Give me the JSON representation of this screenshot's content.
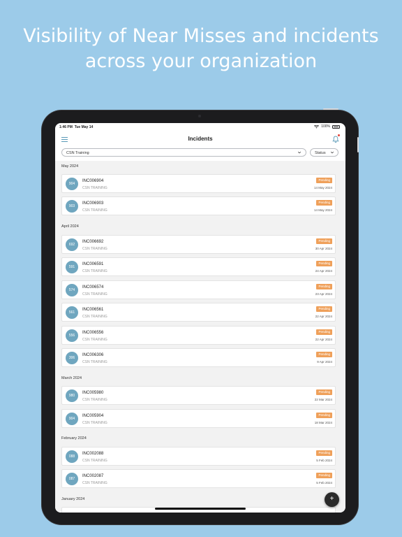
{
  "headline": {
    "line1": "Visibility of Near Misses and incidents",
    "line2": "across your organization"
  },
  "statusbar": {
    "time": "1:46 PM",
    "date": "Tue May 14",
    "battery": "100%"
  },
  "navbar": {
    "title": "Incidents"
  },
  "filters": {
    "group_value": "CSN Training",
    "status_label": "Status"
  },
  "colors": {
    "background": "#9ccbe9",
    "avatar": "#6fa6bf",
    "badge": "#efa05a",
    "accent": "#5a9ab8"
  },
  "months": [
    "May 2024",
    "April 2024",
    "March 2024",
    "February 2024",
    "January 2024"
  ],
  "incidents": [
    {
      "num": "904",
      "id": "INC006904",
      "org": "CSN TRAINING",
      "status": "Pending",
      "date": "14 May 2024"
    },
    {
      "num": "903",
      "id": "INC006903",
      "org": "CSN TRAINING",
      "status": "Pending",
      "date": "14 May 2024"
    },
    {
      "num": "692",
      "id": "INC006692",
      "org": "CSN TRAINING",
      "status": "Pending",
      "date": "30 Apr 2024"
    },
    {
      "num": "591",
      "id": "INC006591",
      "org": "CSN TRAINING",
      "status": "Pending",
      "date": "24 Apr 2024"
    },
    {
      "num": "574",
      "id": "INC006574",
      "org": "CSN TRAINING",
      "status": "Pending",
      "date": "23 Apr 2024"
    },
    {
      "num": "561",
      "id": "INC006561",
      "org": "CSN TRAINING",
      "status": "Pending",
      "date": "22 Apr 2024"
    },
    {
      "num": "556",
      "id": "INC006556",
      "org": "CSN TRAINING",
      "status": "Pending",
      "date": "22 Apr 2024"
    },
    {
      "num": "306",
      "id": "INC006306",
      "org": "CSN TRAINING",
      "status": "Pending",
      "date": "9 Apr 2024"
    },
    {
      "num": "980",
      "id": "INC005980",
      "org": "CSN TRAINING",
      "status": "Pending",
      "date": "22 Mar 2024"
    },
    {
      "num": "904",
      "id": "INC005904",
      "org": "CSN TRAINING",
      "status": "Pending",
      "date": "18 Mar 2024"
    },
    {
      "num": "088",
      "id": "INC002088",
      "org": "CSN TRAINING",
      "status": "Pending",
      "date": "5 Feb 2024"
    },
    {
      "num": "087",
      "id": "INC002087",
      "org": "CSN TRAINING",
      "status": "Pending",
      "date": "5 Feb 2024"
    }
  ],
  "fab_label": "+",
  "icons": {
    "menu": "menu-icon",
    "bell": "bell-icon",
    "dropdown": "chevron-down-icon",
    "add": "plus-icon"
  }
}
